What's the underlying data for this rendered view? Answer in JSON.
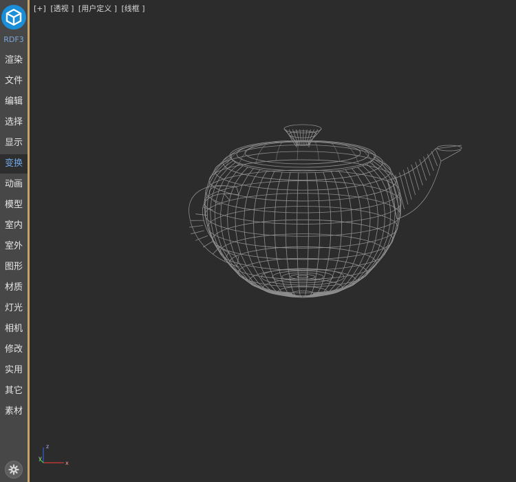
{
  "sidebar": {
    "logo_icon": "rdf-logo-icon",
    "brand": "RDF3",
    "accent_color": "#c8a466",
    "items": [
      {
        "label": "渲染"
      },
      {
        "label": "文件"
      },
      {
        "label": "编辑"
      },
      {
        "label": "选择"
      },
      {
        "label": "显示"
      },
      {
        "label": "变换",
        "active": true
      },
      {
        "label": "动画"
      },
      {
        "label": "模型"
      },
      {
        "label": "室内"
      },
      {
        "label": "室外"
      },
      {
        "label": "图形"
      },
      {
        "label": "材质"
      },
      {
        "label": "灯光"
      },
      {
        "label": "相机"
      },
      {
        "label": "修改"
      },
      {
        "label": "实用"
      },
      {
        "label": "其它"
      },
      {
        "label": "素材"
      }
    ],
    "settings_icon": "gear-icon"
  },
  "viewport": {
    "labels": [
      "[+]",
      "[透视 ]",
      "[用户定义 ]",
      "[线框 ]"
    ],
    "object": "teapot-wireframe",
    "wire_color": "#8f8f8f"
  },
  "axis": {
    "x": "x",
    "y": "y",
    "z": "z"
  }
}
